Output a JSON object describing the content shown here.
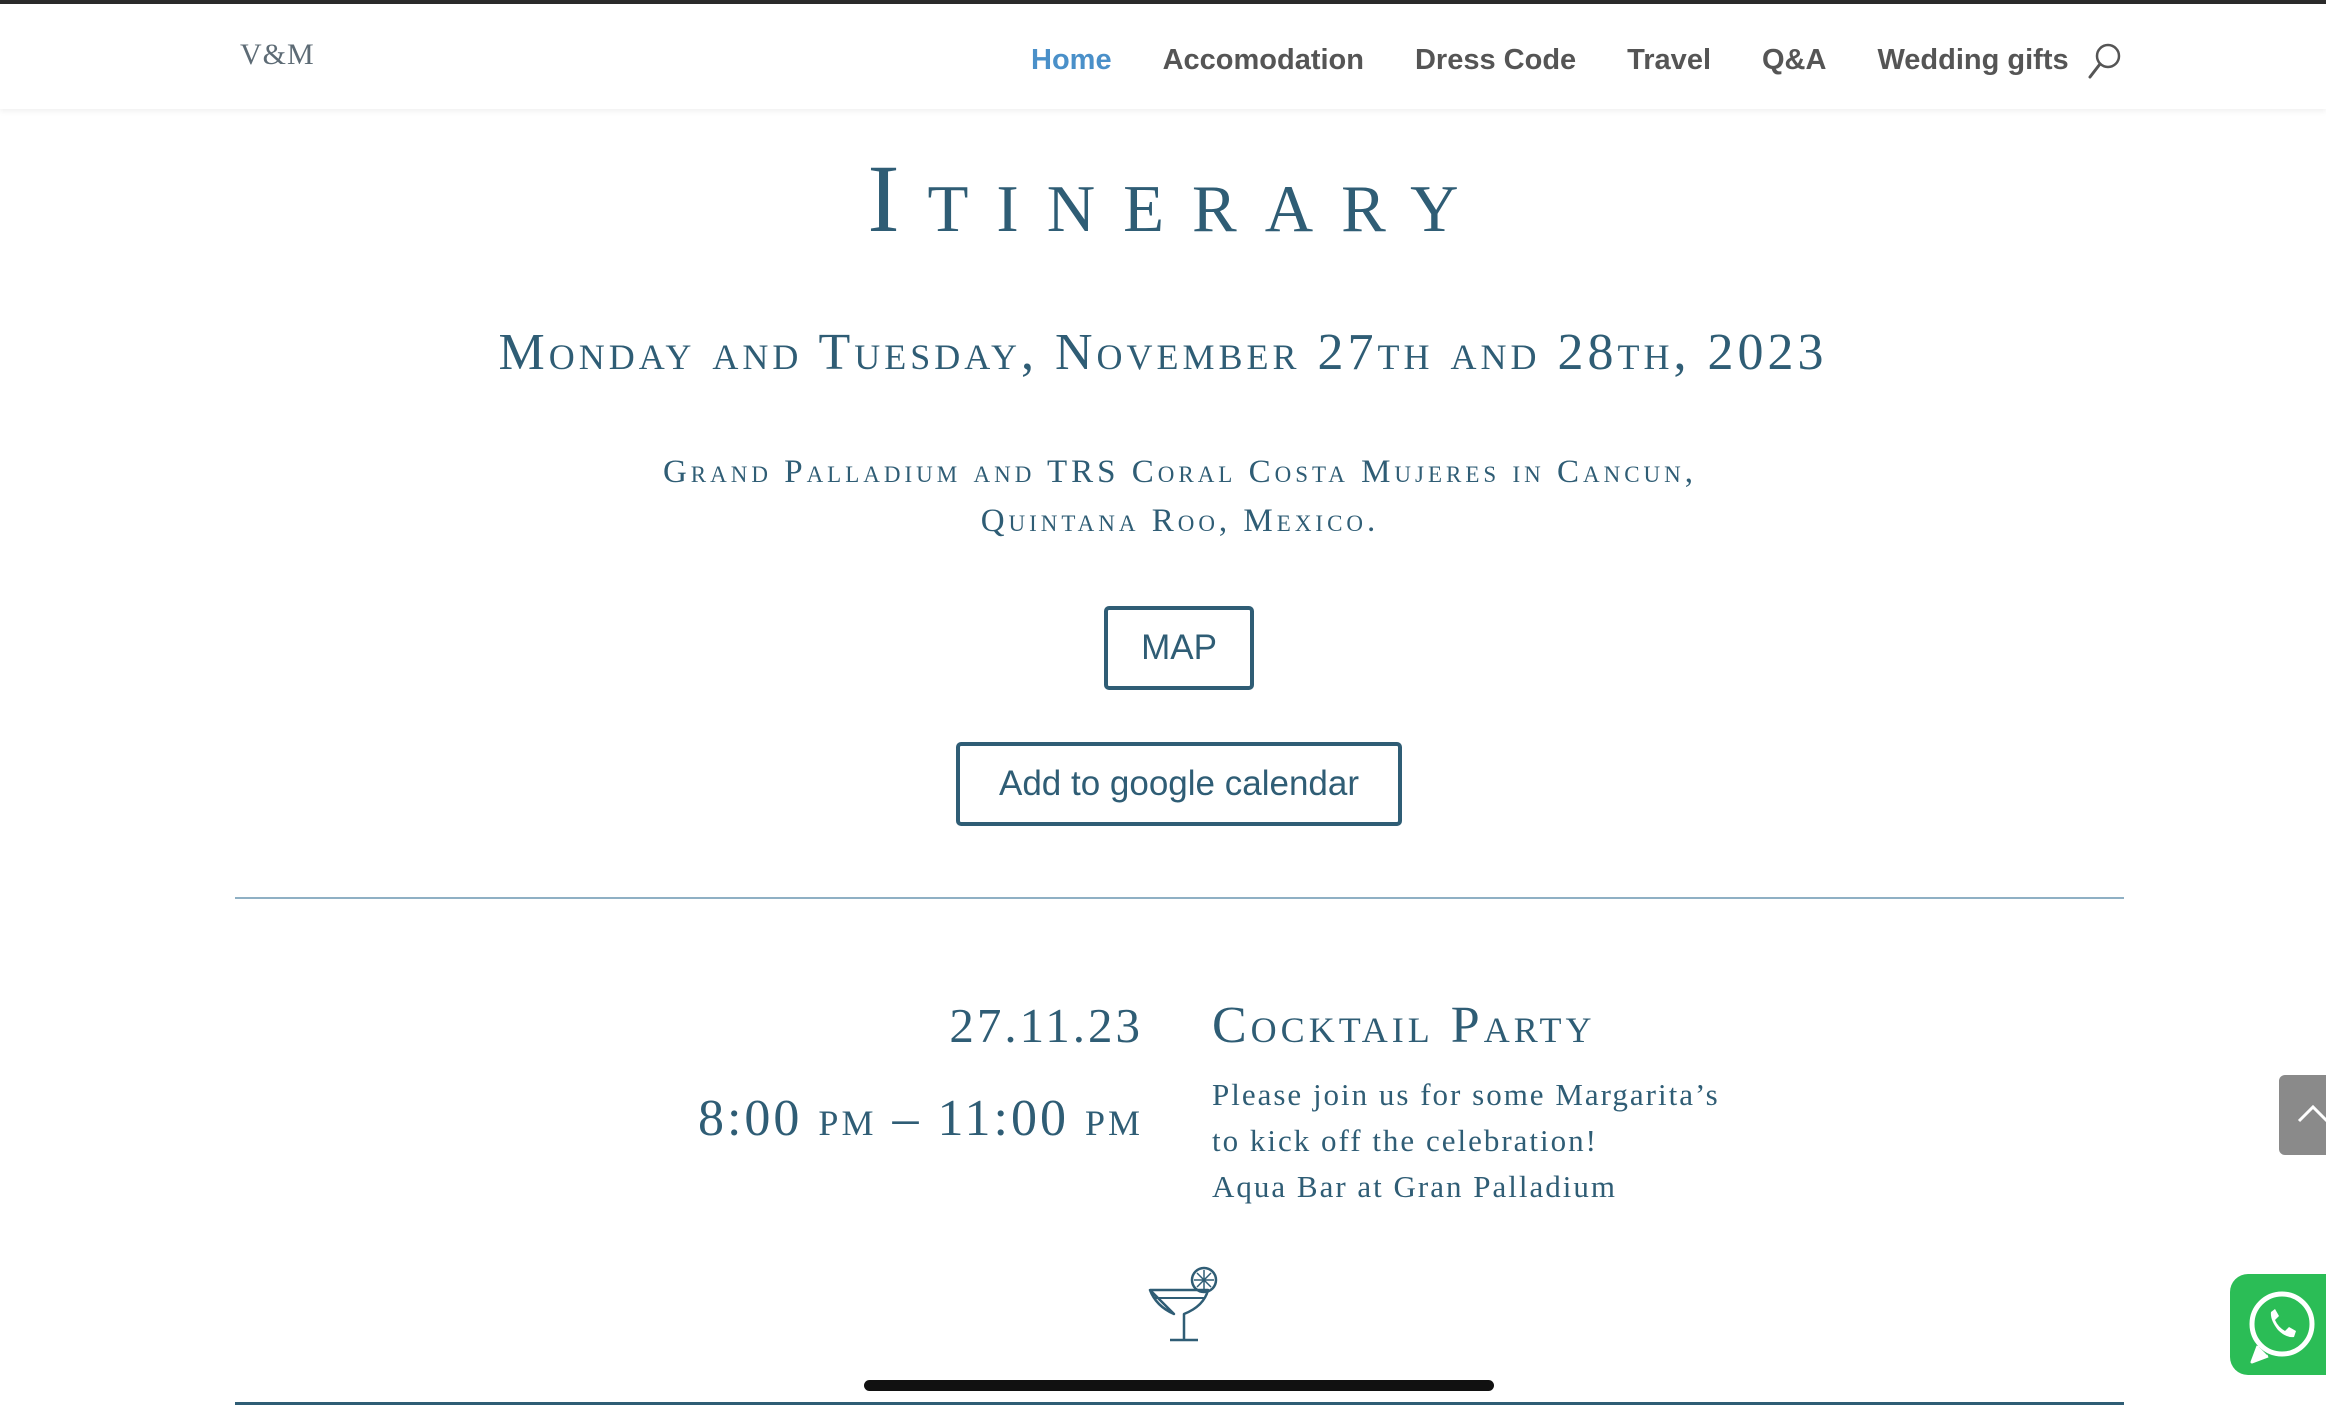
{
  "header": {
    "logo": "V&M",
    "nav": [
      "Home",
      "Accomodation",
      "Dress Code",
      "Travel",
      "Q&A",
      "Wedding gifts"
    ],
    "active_nav": "Home",
    "search_icon": "search-icon"
  },
  "page": {
    "title": "Itinerary",
    "subtitle": "Monday and Tuesday, November 27th and 28th, 2023",
    "location_line1": "Grand Palladium and TRS Coral Costa Mujeres in Cancun,",
    "location_line2": "Quintana Roo, Mexico.",
    "map_button": "MAP",
    "calendar_button": "Add to google calendar"
  },
  "event": {
    "date": "27.11.23",
    "time": "8:00 pm – 11:00 pm",
    "title": "Cocktail Party",
    "desc_line1": "Please join us for some Margarita’s",
    "desc_line2": "to kick off the celebration!",
    "desc_line3": "Aqua Bar at Gran Palladium",
    "icon": "cocktail-icon"
  },
  "widgets": {
    "scroll_top_icon": "chevron-up-icon",
    "whatsapp_icon": "whatsapp-icon"
  },
  "colors": {
    "accent": "#2f5d75",
    "nav_active": "#4a90c9",
    "nav_text": "#555555",
    "whatsapp": "#2bbd56"
  }
}
